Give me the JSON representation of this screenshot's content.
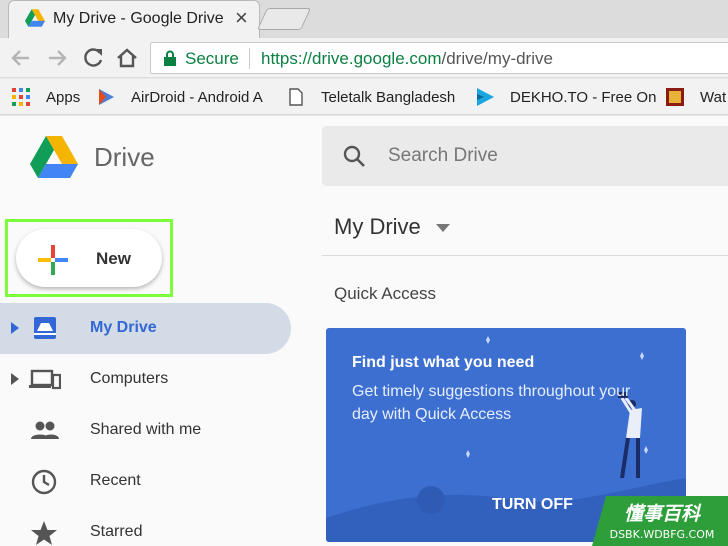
{
  "browser": {
    "tab_title": "My Drive - Google Drive",
    "tab_close": "×",
    "secure_label": "Secure",
    "url_host": "https://drive.google.com",
    "url_path": "/drive/my-drive"
  },
  "bookmarks": [
    {
      "label": "Apps",
      "icon": "apps-grid-icon"
    },
    {
      "label": "AirDroid - Android A",
      "icon": "airdroid-icon"
    },
    {
      "label": "Teletalk Bangladesh",
      "icon": "page-icon"
    },
    {
      "label": "DEKHO.TO - Free On",
      "icon": "dekho-icon"
    },
    {
      "label": "Wat",
      "icon": "film-icon"
    }
  ],
  "drive": {
    "wordmark": "Drive",
    "search_placeholder": "Search Drive",
    "new_label": "New",
    "nav": [
      {
        "label": "My Drive",
        "icon": "my-drive-icon",
        "active": true,
        "expandable": true
      },
      {
        "label": "Computers",
        "icon": "computers-icon",
        "active": false,
        "expandable": true
      },
      {
        "label": "Shared with me",
        "icon": "shared-people-icon",
        "active": false,
        "expandable": false
      },
      {
        "label": "Recent",
        "icon": "clock-icon",
        "active": false,
        "expandable": false
      },
      {
        "label": "Starred",
        "icon": "star-icon",
        "active": false,
        "expandable": false
      }
    ],
    "main_title": "My Drive",
    "quick_access_label": "Quick Access",
    "quick_access_card": {
      "heading": "Find just what you need",
      "body": "Get timely suggestions throughout your day with Quick Access",
      "action": "TURN OFF"
    }
  },
  "watermark": {
    "cn": "懂事百科",
    "site": "DSBK.WDBFG.COM"
  },
  "colors": {
    "accent_blue": "#3367d6",
    "card_blue": "#3d6fd1",
    "secure_green": "#0b8043",
    "highlight_green": "#7cfc3a"
  }
}
